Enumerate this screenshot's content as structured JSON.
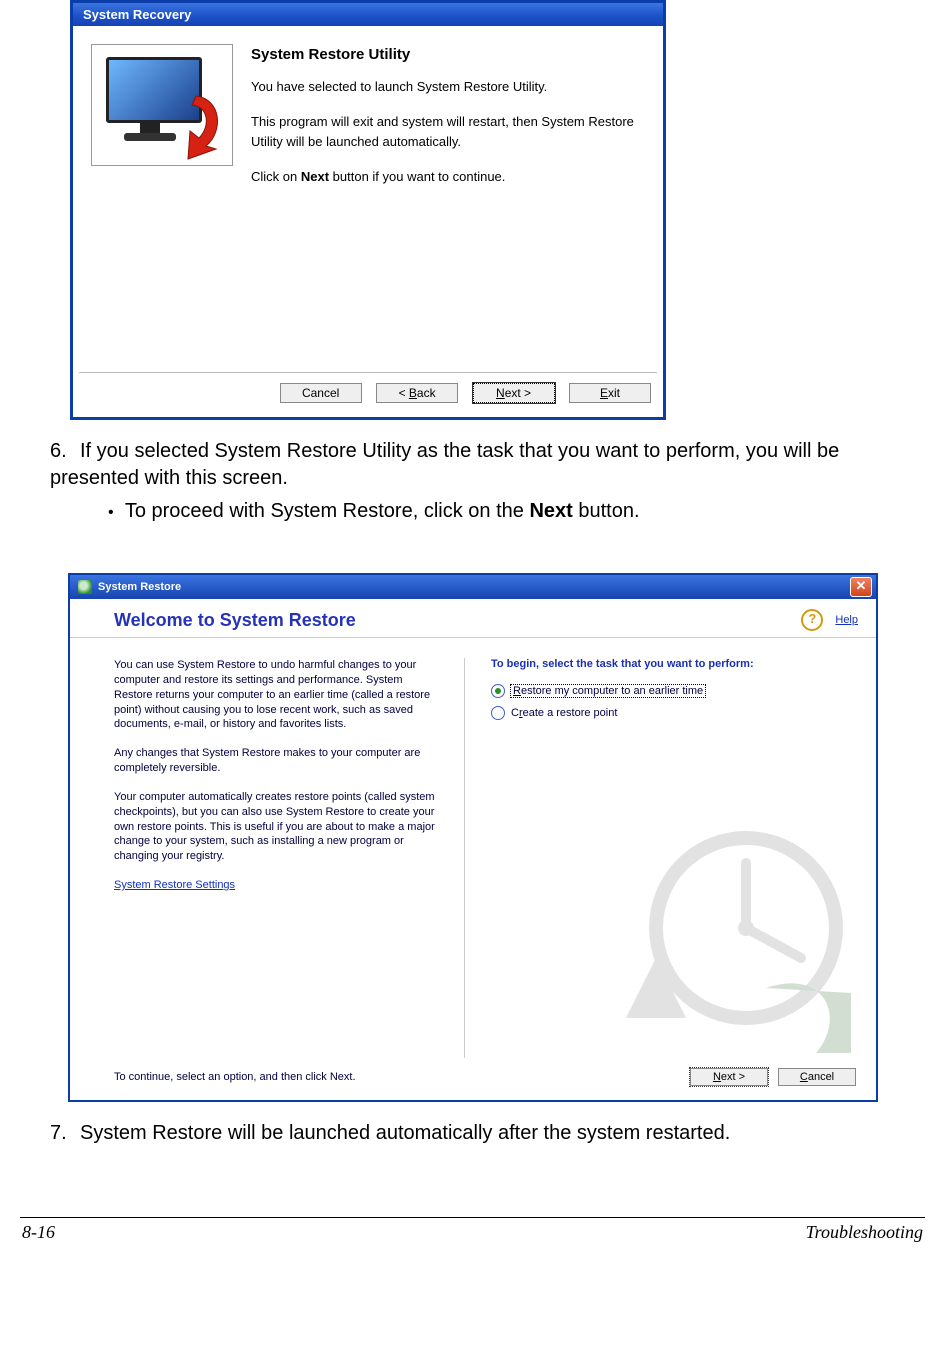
{
  "dialog1": {
    "title": "System Recovery",
    "heading": "System Restore Utility",
    "p1": "You have selected to launch System Restore Utility.",
    "p2": "This program will exit and system will restart, then System Restore Utility will be launched automatically.",
    "p3a": "Click on ",
    "p3b": "Next",
    "p3c": " button if you want to continue.",
    "buttons": {
      "cancel": "Cancel",
      "back_prefix": "< ",
      "back_u": "B",
      "back_rest": "ack",
      "next_u": "N",
      "next_rest": "ext >",
      "exit_u": "E",
      "exit_rest": "xit"
    }
  },
  "step6": {
    "num": "6.",
    "text_a": "If you selected System Restore Utility as the task that you want to perform, you will be presented with this screen.",
    "bullet_a": "To proceed with System Restore, click on the ",
    "bullet_b": "Next",
    "bullet_c": " button."
  },
  "dialog2": {
    "title": "System Restore",
    "header": "Welcome to System Restore",
    "help_label": "Help",
    "left": {
      "p1": "You can use System Restore to undo harmful changes to your computer and restore its settings and performance. System Restore returns your computer to an earlier time (called a restore point) without causing you to lose recent work, such as saved documents, e-mail, or history and favorites lists.",
      "p2": "Any changes that System Restore makes to your computer are completely reversible.",
      "p3": "Your computer automatically creates restore points (called system checkpoints), but you can also use System Restore to create your own restore points. This is useful if you are about to make a major change to your system, such as installing a new program or changing your registry.",
      "settings_link": "System Restore Settings"
    },
    "right": {
      "prompt": "To begin, select the task that you want to perform:",
      "opt1_u": "R",
      "opt1_rest": "estore my computer to an earlier time",
      "opt2_pre": "C",
      "opt2_u": "r",
      "opt2_rest": "eate a restore point"
    },
    "footer": {
      "text": "To continue, select an option, and then click Next.",
      "next_u": "N",
      "next_rest": "ext >",
      "cancel_u": "C",
      "cancel_rest": "ancel"
    }
  },
  "step7": {
    "num": "7.",
    "text": "System Restore will be launched automatically after the system restarted."
  },
  "pagefoot": {
    "left": "8-16",
    "right": "Troubleshooting"
  }
}
